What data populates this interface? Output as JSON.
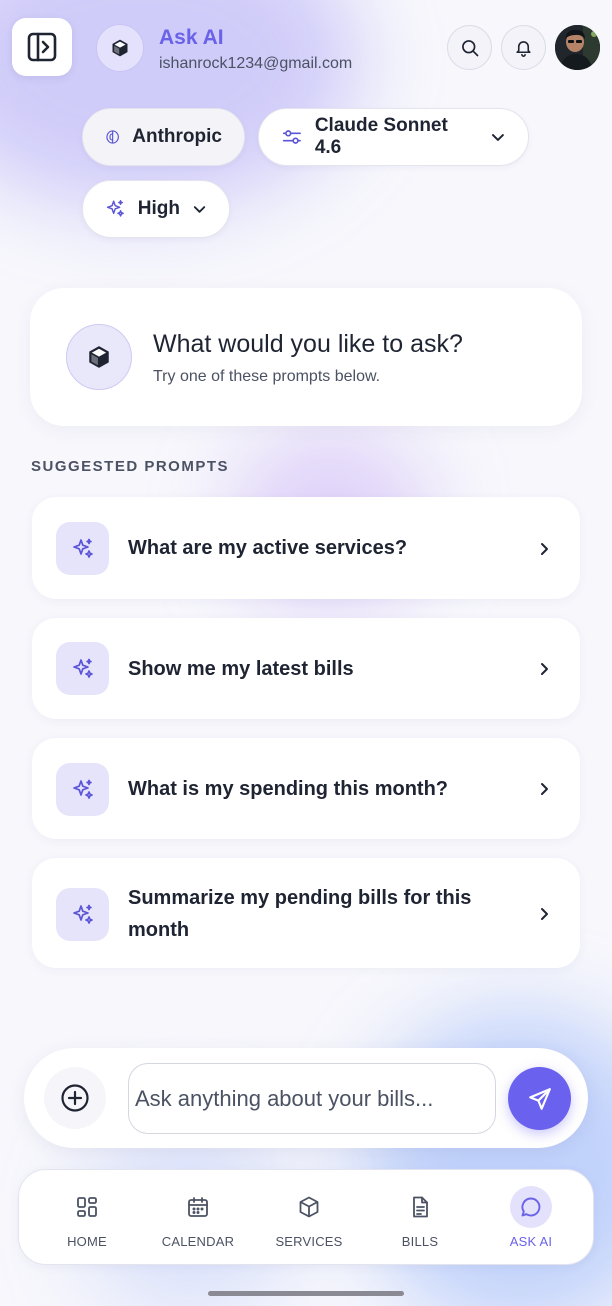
{
  "header": {
    "title": "Ask AI",
    "email": "ishanrock1234@gmail.com"
  },
  "selectors": {
    "provider": "Anthropic",
    "model": "Claude Sonnet 4.6",
    "effort": "High"
  },
  "welcome": {
    "title": "What would you like to ask?",
    "subtitle": "Try one of these prompts below."
  },
  "suggested": {
    "label": "SUGGESTED PROMPTS",
    "items": [
      {
        "text": "What are my active services?"
      },
      {
        "text": "Show me my latest bills"
      },
      {
        "text": "What is my spending this month?"
      },
      {
        "text": "Summarize my pending bills for this month"
      }
    ]
  },
  "composer": {
    "placeholder": "Ask anything about your bills..."
  },
  "nav": {
    "items": [
      {
        "label": "HOME",
        "icon": "grid-icon"
      },
      {
        "label": "CALENDAR",
        "icon": "calendar-icon"
      },
      {
        "label": "SERVICES",
        "icon": "box-icon"
      },
      {
        "label": "BILLS",
        "icon": "document-icon"
      },
      {
        "label": "ASK AI",
        "icon": "chat-bubble-icon"
      }
    ],
    "active": "ASK AI"
  },
  "colors": {
    "accent": "#6a62e8",
    "accent_light": "#e3e1fb",
    "background": "#f7f7fc",
    "text_primary": "#1f2433",
    "text_secondary": "#4b5263"
  }
}
